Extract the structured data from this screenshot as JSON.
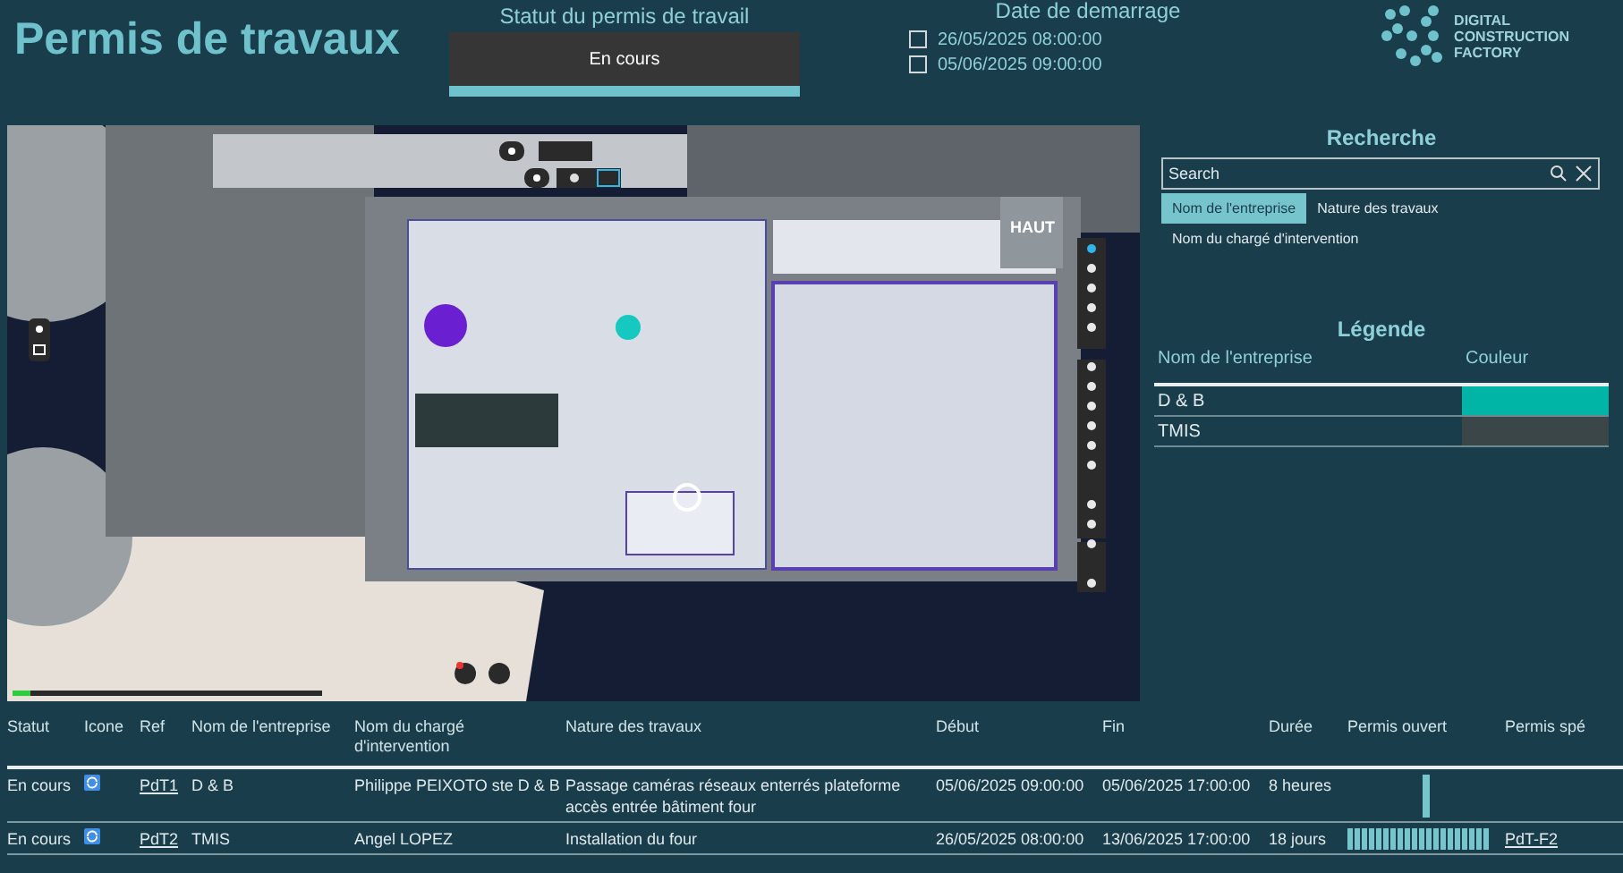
{
  "title": "Permis de travaux",
  "status_filter": {
    "label": "Statut du permis de travail",
    "value": "En cours"
  },
  "date_filter": {
    "label": "Date de demarrage",
    "options": [
      {
        "label": "26/05/2025 08:00:00",
        "checked": false
      },
      {
        "label": "05/06/2025 09:00:00",
        "checked": false
      }
    ]
  },
  "logo": {
    "lines": [
      "DIGITAL",
      "CONSTRUCTION",
      "FACTORY"
    ]
  },
  "viewer": {
    "view_cube_label": "HAUT",
    "progress": {
      "level": 0.06
    }
  },
  "search": {
    "title": "Recherche",
    "placeholder": "Search",
    "fields": [
      {
        "label": "Nom de l'entreprise",
        "selected": true
      },
      {
        "label": "Nature des travaux",
        "selected": false
      },
      {
        "label": "Nom du chargé d'intervention",
        "selected": false
      }
    ]
  },
  "legend": {
    "title": "Légende",
    "columns": [
      "Nom de l'entreprise",
      "Couleur"
    ],
    "rows": [
      {
        "name": "D & B",
        "color": "#00b5a6"
      },
      {
        "name": "TMIS",
        "color": "#3b4648"
      }
    ]
  },
  "table": {
    "columns": [
      "Statut",
      "Icone",
      "Ref",
      "Nom de l'entreprise",
      "Nom du chargé d'intervention",
      "Nature des travaux",
      "Début",
      "Fin",
      "Durée",
      "Permis ouvert",
      "Permis spé"
    ],
    "rows": [
      {
        "statut": "En cours",
        "ref": "PdT1",
        "entreprise": "D & B",
        "charge": "Philippe PEIXOTO ste D & B",
        "nature": "Passage caméras réseaux enterrés plateforme accès entrée bâtiment four",
        "debut": "05/06/2025 09:00:00",
        "fin": "05/06/2025 17:00:00",
        "duree": "8 heures",
        "permis_ouvert": {
          "kind": "single"
        }
      },
      {
        "statut": "En cours",
        "ref": "PdT2",
        "entreprise": "TMIS",
        "charge": "Angel LOPEZ",
        "nature": "Installation du four",
        "debut": "26/05/2025 08:00:00",
        "fin": "13/06/2025 17:00:00",
        "duree": "18 jours",
        "permis_ouvert": {
          "kind": "striped"
        },
        "permis_spe": "PdT-F2"
      }
    ]
  }
}
